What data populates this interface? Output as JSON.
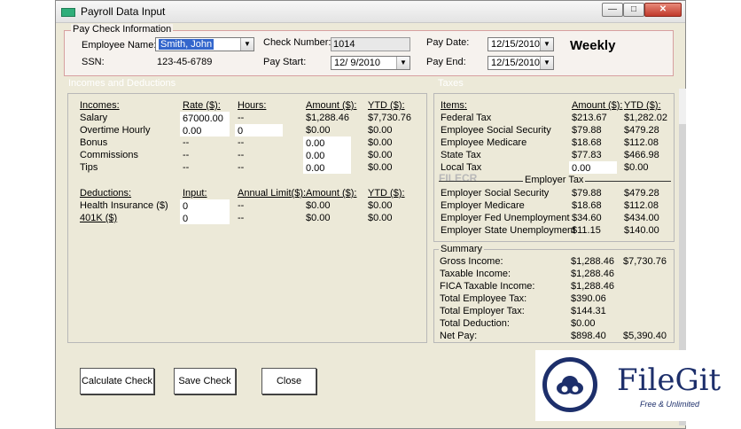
{
  "window": {
    "title": "Payroll Data Input"
  },
  "paycheck": {
    "group_label": "Pay Check Information",
    "employee_name_label": "Employee Name:",
    "employee_name_value": "Smith, John",
    "ssn_label": "SSN:",
    "ssn_value": "123-45-6789",
    "check_number_label": "Check Number:",
    "check_number_value": "1014",
    "pay_start_label": "Pay Start:",
    "pay_start_value": "12/ 9/2010",
    "pay_date_label": "Pay Date:",
    "pay_date_value": "12/15/2010",
    "pay_end_label": "Pay End:",
    "pay_end_value": "12/15/2010",
    "frequency": "Weekly"
  },
  "incomes": {
    "section_label": "Incomes and Deductions",
    "headers": {
      "item": "Incomes:",
      "rate": "Rate ($):",
      "hours": "Hours:",
      "amount": "Amount ($):",
      "ytd": "YTD ($):"
    },
    "rows": [
      {
        "item": "Salary",
        "rate": "67000.00",
        "hours": "--",
        "amount": "$1,288.46",
        "ytd": "$7,730.76"
      },
      {
        "item": "Overtime Hourly",
        "rate": "0.00",
        "hours": "0",
        "amount": "$0.00",
        "ytd": "$0.00"
      },
      {
        "item": "Bonus",
        "rate": "--",
        "hours": "--",
        "amount": "0.00",
        "ytd": "$0.00"
      },
      {
        "item": "Commissions",
        "rate": "--",
        "hours": "--",
        "amount": "0.00",
        "ytd": "$0.00"
      },
      {
        "item": "Tips",
        "rate": "--",
        "hours": "--",
        "amount": "0.00",
        "ytd": "$0.00"
      }
    ]
  },
  "deductions": {
    "headers": {
      "item": "Deductions:",
      "input": "Input:",
      "limit": "Annual Limit($):",
      "amount": "Amount ($):",
      "ytd": "YTD ($):"
    },
    "rows": [
      {
        "item": "Health Insurance  ($)",
        "input": "0",
        "limit": "--",
        "amount": "$0.00",
        "ytd": "$0.00"
      },
      {
        "item": "401K  ($)",
        "input": "0",
        "limit": "--",
        "amount": "$0.00",
        "ytd": "$0.00"
      }
    ]
  },
  "taxes": {
    "section_label": "Taxes",
    "headers": {
      "item": "Items:",
      "amount": "Amount ($):",
      "ytd": "YTD ($):"
    },
    "employee_rows": [
      {
        "item": "Federal Tax",
        "amount": "$213.67",
        "ytd": "$1,282.02"
      },
      {
        "item": "Employee Social Security",
        "amount": "$79.88",
        "ytd": "$479.28"
      },
      {
        "item": "Employee Medicare",
        "amount": "$18.68",
        "ytd": "$112.08"
      },
      {
        "item": "State Tax",
        "amount": "$77.83",
        "ytd": "$466.98"
      },
      {
        "item": "Local Tax",
        "amount": "0.00",
        "ytd": "$0.00"
      }
    ],
    "employer_heading": "Employer Tax",
    "employer_rows": [
      {
        "item": "Employer Social Security",
        "amount": "$79.88",
        "ytd": "$479.28"
      },
      {
        "item": "Employer Medicare",
        "amount": "$18.68",
        "ytd": "$112.08"
      },
      {
        "item": "Employer Fed Unemployment",
        "amount": "$34.60",
        "ytd": "$434.00"
      },
      {
        "item": "Employer State Unemployment",
        "amount": "$11.15",
        "ytd": "$140.00"
      }
    ]
  },
  "summary": {
    "label": "Summary",
    "rows": [
      {
        "item": "Gross Income:",
        "amount": "$1,288.46",
        "ytd": "$7,730.76"
      },
      {
        "item": "Taxable Income:",
        "amount": "$1,288.46",
        "ytd": ""
      },
      {
        "item": "FICA Taxable Income:",
        "amount": "$1,288.46",
        "ytd": ""
      },
      {
        "item": "Total Employee Tax:",
        "amount": "$390.06",
        "ytd": ""
      },
      {
        "item": "Total Employer Tax:",
        "amount": "$144.31",
        "ytd": ""
      },
      {
        "item": "Total Deduction:",
        "amount": "$0.00",
        "ytd": ""
      },
      {
        "item": "Net Pay:",
        "amount": "$898.40",
        "ytd": "$5,390.40"
      }
    ]
  },
  "buttons": {
    "calculate": "Calculate Check",
    "save": "Save Check",
    "close": "Close"
  },
  "watermark": {
    "text": "FILECR",
    "brand": "FileGit",
    "tagline": "Free & Unlimited"
  },
  "colors": {
    "section_header": "#ffffff",
    "selection": "#3366cc",
    "brand": "#1d2f6b"
  }
}
